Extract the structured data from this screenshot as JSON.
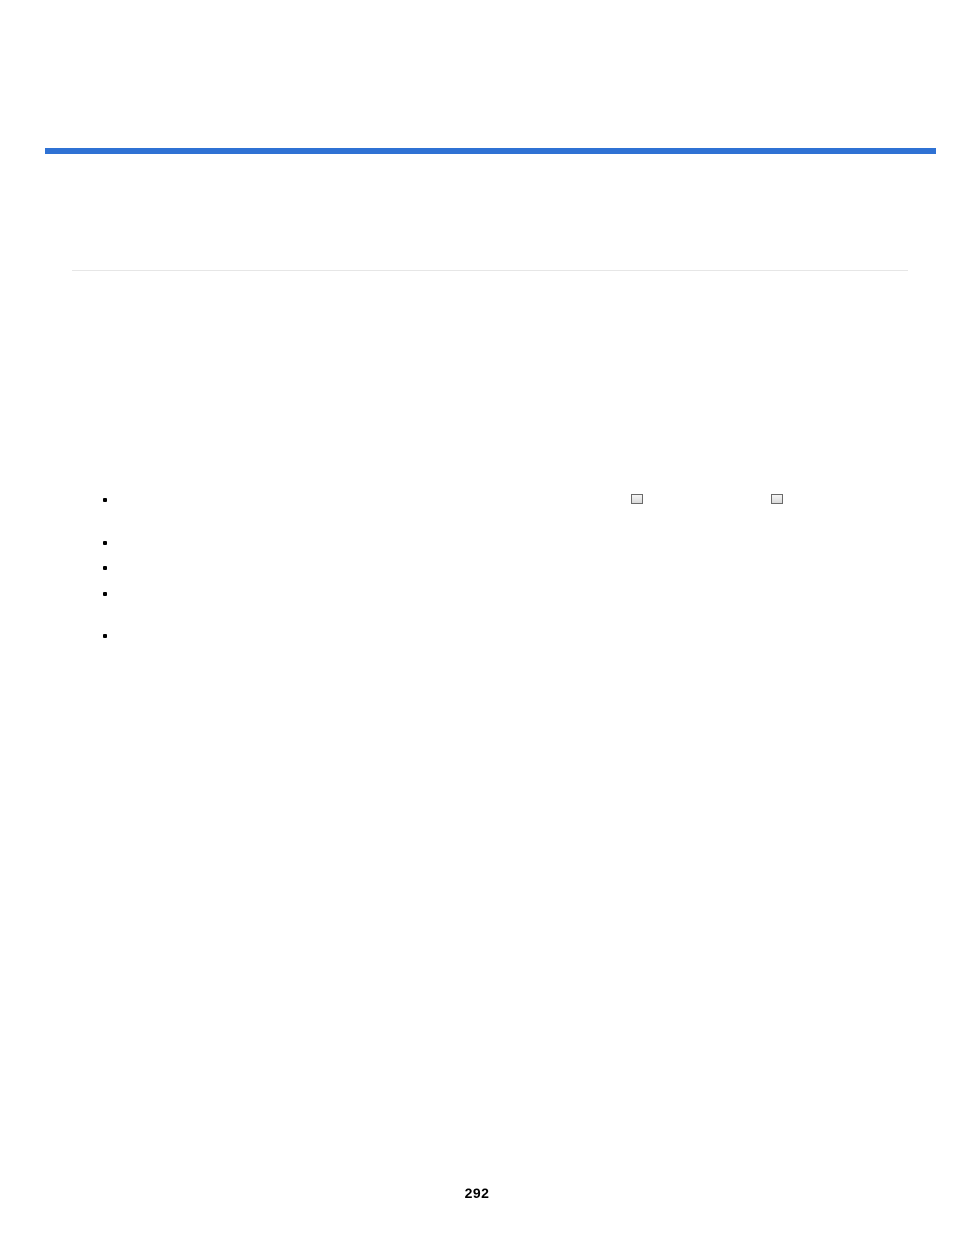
{
  "page": {
    "number": "292"
  },
  "icons": {
    "first": "document-icon",
    "second": "folder-icon"
  }
}
